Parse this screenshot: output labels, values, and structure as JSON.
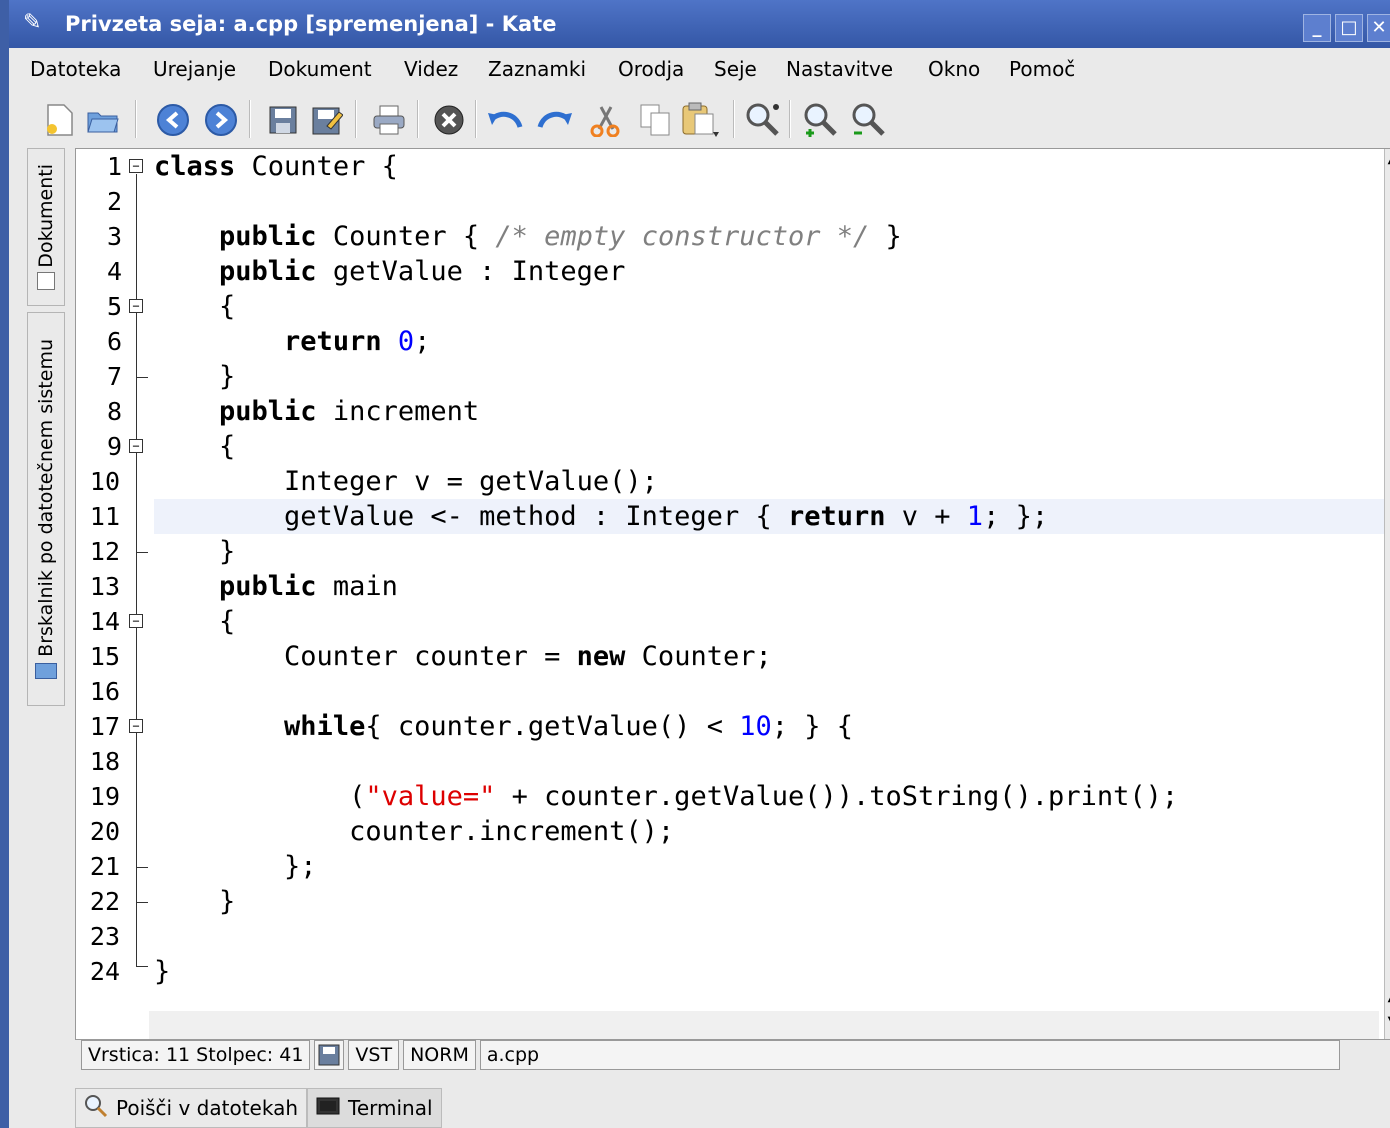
{
  "window": {
    "title": "Privzeta seja: a.cpp [spremenjena] - Kate",
    "controls": [
      "_",
      "□",
      "✕"
    ]
  },
  "menubar": {
    "items": [
      {
        "label": "Datoteka"
      },
      {
        "label": "Urejanje"
      },
      {
        "label": "Dokument"
      },
      {
        "label": "Videz"
      },
      {
        "label": "Zaznamki"
      },
      {
        "label": "Orodja"
      },
      {
        "label": "Seje"
      },
      {
        "label": "Nastavitve"
      },
      {
        "label": "Okno"
      },
      {
        "label": "Pomoč"
      }
    ]
  },
  "toolbar": {
    "icons": [
      "new-file-icon",
      "open-file-icon",
      "back-icon",
      "forward-icon",
      "save-icon",
      "save-as-icon",
      "print-icon",
      "close-document-icon",
      "undo-icon",
      "redo-icon",
      "cut-icon",
      "copy-icon",
      "paste-icon",
      "find-icon",
      "zoom-in-icon",
      "zoom-out-icon"
    ]
  },
  "sidebar": {
    "tabs": [
      {
        "label": "Dokumenti",
        "icon": "documents-icon"
      },
      {
        "label": "Brskalnik po datotečnem sistemu",
        "icon": "folder-icon"
      }
    ]
  },
  "editor": {
    "current_line": 11,
    "lines": [
      "1",
      "2",
      "3",
      "4",
      "5",
      "6",
      "7",
      "8",
      "9",
      "10",
      "11",
      "12",
      "13",
      "14",
      "15",
      "16",
      "17",
      "18",
      "19",
      "20",
      "21",
      "22",
      "23",
      "24"
    ]
  },
  "statusbar": {
    "position": "Vrstica: 11 Stolpec: 41",
    "mode_ins": "VST",
    "mode_norm": "NORM",
    "filename": "a.cpp"
  },
  "bottom_tabs": {
    "find_in_files": "Poišči v datotekah",
    "terminal": "Terminal"
  },
  "colors": {
    "titlebar": "#3457a6",
    "keyword": "#000000",
    "number": "#0000ff",
    "string": "#dd0000",
    "comment": "#808080",
    "current_line_bg": "#eef2fb"
  }
}
